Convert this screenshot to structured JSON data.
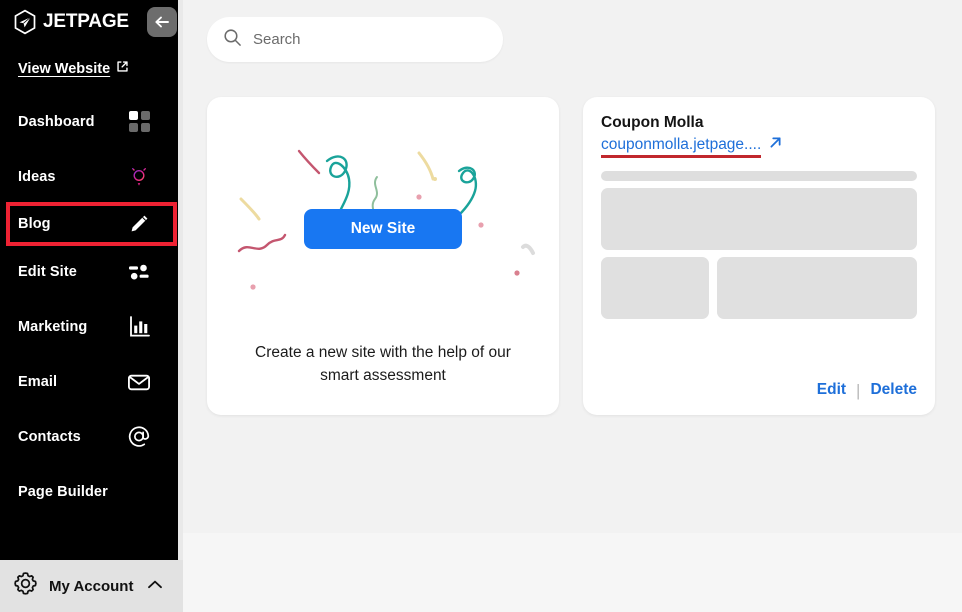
{
  "sidebar": {
    "brand": "JETPAGE",
    "logo_icon": "jetpage-hexagon-paperplane-logo",
    "back_button_icon": "arrow-left-icon",
    "view_website": {
      "label": "View Website",
      "icon": "external-link-icon"
    },
    "items": [
      {
        "label": "Dashboard",
        "icon": "grid-squares-icon",
        "highlighted": false
      },
      {
        "label": "Ideas",
        "icon": "lightbulb-icon",
        "highlighted": false
      },
      {
        "label": "Blog",
        "icon": "pencil-edit-icon",
        "highlighted": true
      },
      {
        "label": "Edit Site",
        "icon": "sliders-icon",
        "highlighted": false
      },
      {
        "label": "Marketing",
        "icon": "bar-chart-icon",
        "highlighted": false
      },
      {
        "label": "Email",
        "icon": "envelope-icon",
        "highlighted": false
      },
      {
        "label": "Contacts",
        "icon": "at-sign-icon",
        "highlighted": false
      },
      {
        "label": "Page Builder",
        "icon": "",
        "highlighted": false
      }
    ],
    "footer": {
      "label": "My Account",
      "icon": "gear-icon",
      "caret": "chevron-up-icon"
    }
  },
  "search": {
    "placeholder": "Search",
    "value": "",
    "icon": "search-icon"
  },
  "cards": {
    "new_site": {
      "button_label": "New Site",
      "caption": "Create a new site with the help of our smart assessment",
      "button_color": "#1877f2"
    },
    "site": {
      "title": "Coupon Molla",
      "url": "couponmolla.jetpage....",
      "url_icon": "arrow-up-right-icon",
      "url_color": "#1e6fd9",
      "underline_color": "#c1272d",
      "edit_label": "Edit",
      "delete_label": "Delete",
      "separator": "|"
    }
  },
  "annotation": {
    "highlight_color": "#ee2233",
    "target": "Blog"
  }
}
